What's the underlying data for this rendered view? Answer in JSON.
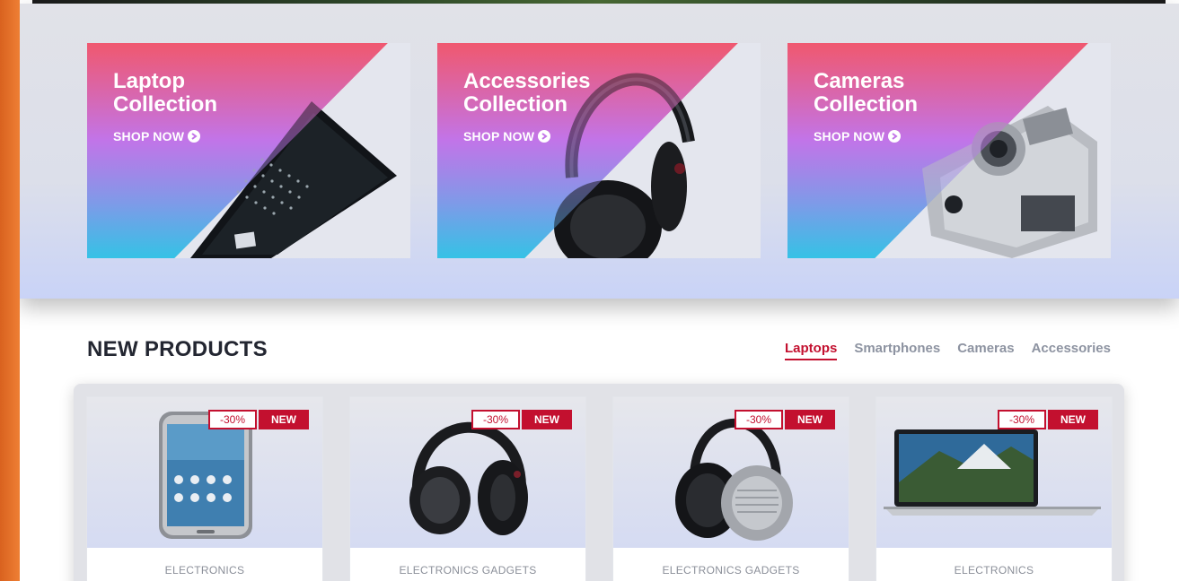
{
  "collections": [
    {
      "title_line1": "Laptop",
      "title_line2": "Collection",
      "cta": "SHOP NOW",
      "icon": "laptop-icon"
    },
    {
      "title_line1": "Accessories",
      "title_line2": "Collection",
      "cta": "SHOP NOW",
      "icon": "headphones-icon"
    },
    {
      "title_line1": "Cameras",
      "title_line2": "Collection",
      "cta": "SHOP NOW",
      "icon": "camera-icon"
    }
  ],
  "new_products": {
    "title": "NEW PRODUCTS",
    "tabs": [
      "Laptops",
      "Smartphones",
      "Cameras",
      "Accessories"
    ],
    "active_tab": "Laptops"
  },
  "products": [
    {
      "sale_badge": "-30%",
      "new_badge": "NEW",
      "category": "ELECTRONICS",
      "image": "smartphone-icon"
    },
    {
      "sale_badge": "-30%",
      "new_badge": "NEW",
      "category": "ELECTRONICS GADGETS",
      "image": "headphones-icon"
    },
    {
      "sale_badge": "-30%",
      "new_badge": "NEW",
      "category": "ELECTRONICS GADGETS",
      "image": "headphones-icon"
    },
    {
      "sale_badge": "-30%",
      "new_badge": "NEW",
      "category": "ELECTRONICS",
      "image": "laptop-icon"
    }
  ],
  "colors": {
    "accent": "#c3102f",
    "page_edge": "#e5712a",
    "gradient_top": "#f0586f",
    "gradient_mid": "#c274e8",
    "gradient_bottom": "#35c2e6"
  }
}
